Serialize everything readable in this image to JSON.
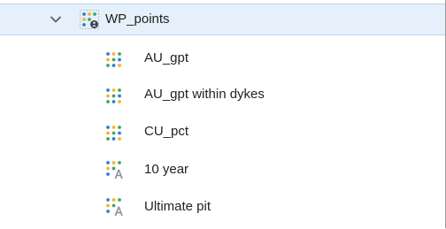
{
  "tree": {
    "root": {
      "label": "WP_points",
      "icon": "points-object-icon",
      "expanded": true,
      "selected": true
    },
    "children": [
      {
        "label": "AU_gpt",
        "icon": "color-points-attribute-icon"
      },
      {
        "label": "AU_gpt within dykes",
        "icon": "color-points-attribute-icon"
      },
      {
        "label": "CU_pct",
        "icon": "color-points-attribute-icon"
      },
      {
        "label": "10 year",
        "icon": "text-points-attribute-icon"
      },
      {
        "label": "Ultimate pit",
        "icon": "text-points-attribute-icon"
      }
    ]
  },
  "colors": {
    "selection_bg": "#e5f0fb",
    "selection_border": "#b8d4f1",
    "dot_blue": "#2f7fd6",
    "dot_yellow": "#f2b72a",
    "dot_green": "#3ea85a",
    "dot_grey": "#8a8f99",
    "text": "#222222"
  }
}
